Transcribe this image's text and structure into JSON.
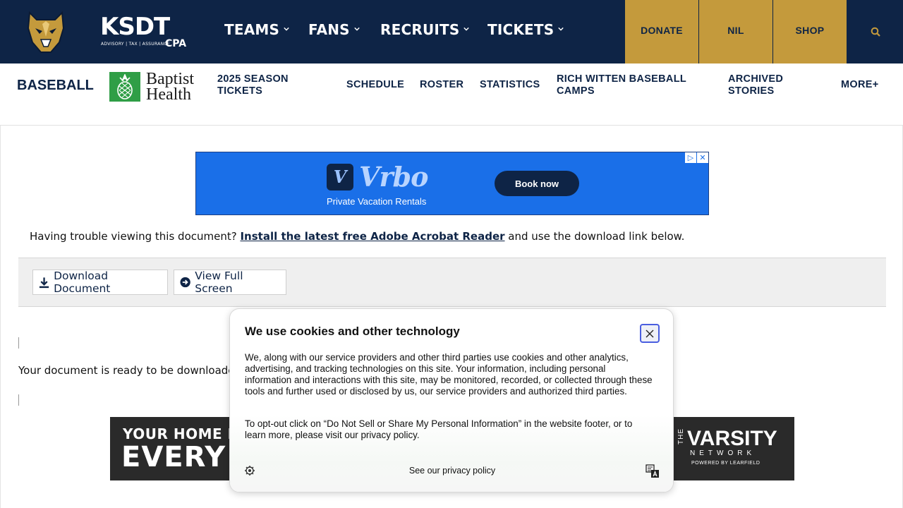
{
  "header": {
    "brand_word": "KSDT",
    "brand_sub": "ADVISORY | TAX | ASSURANCE",
    "brand_cpa": "CPA",
    "nav": [
      {
        "label": "TEAMS"
      },
      {
        "label": "FANS"
      },
      {
        "label": "RECRUITS"
      },
      {
        "label": "TICKETS"
      }
    ],
    "donate": "DONATE",
    "nil": "NIL",
    "shop": "SHOP",
    "colors": {
      "navy": "#0e2446",
      "gold": "#c49a3c"
    }
  },
  "subnav": {
    "sport": "BASEBALL",
    "sponsor_line1": "Baptist",
    "sponsor_line2": "Health",
    "links": [
      {
        "line1": "2025 SEASON",
        "line2": "TICKETS"
      },
      {
        "line1": "SCHEDULE"
      },
      {
        "line1": "ROSTER"
      },
      {
        "line1": "STATISTICS"
      },
      {
        "line1": "RICH WITTEN BASEBALL",
        "line2": "CAMPS"
      },
      {
        "line1": "ARCHIVED",
        "line2": "STORIES"
      },
      {
        "line1": "MORE+"
      }
    ]
  },
  "ad_top": {
    "brand": "Vrbo",
    "tagline": "Private Vacation Rentals",
    "cta": "Book now"
  },
  "document": {
    "trouble_prefix": "Having trouble viewing this document?",
    "trouble_link": "Install the latest free Adobe Acrobat Reader",
    "trouble_suffix": "and use the download link below.",
    "download_label": "Download Document",
    "fullscreen_label": "View Full Screen",
    "ready_text": "Your document is ready to be downloaded"
  },
  "ad_bottom": {
    "line1": "YOUR HOME FOR",
    "line2": "EVERY HO",
    "network_the": "THE",
    "network_word": "VARSITY",
    "network_sub": "NETWORK",
    "powered": "POWERED BY LEARFIELD"
  },
  "cookie": {
    "title": "We use cookies and other technology",
    "body": "We, along with our service providers and other third parties use cookies and other analytics, advertising, and tracking technologies on this site. Your information, including personal information and interactions with this site, may be monitored, recorded, or collected through these tools and further used or disclosed by us, our service providers and authorized third parties.",
    "body2": "To opt-out click on “Do Not Sell or Share My Personal Information” in the website footer, or to learn more, please visit our privacy policy.",
    "policy_link": "See our privacy policy"
  }
}
